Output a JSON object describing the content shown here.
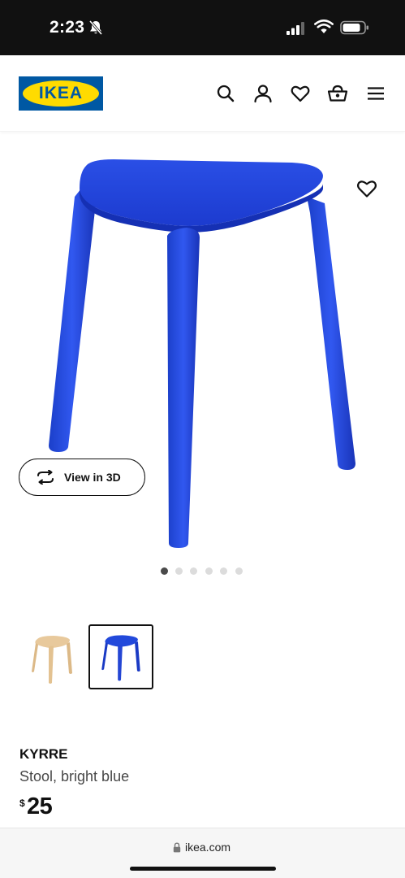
{
  "status_bar": {
    "time": "2:23",
    "icons": [
      "bell-slash-icon",
      "cellular-signal-icon",
      "wifi-icon",
      "battery-icon"
    ]
  },
  "header": {
    "logo_text": "IKEA",
    "icons": [
      "search-icon",
      "user-icon",
      "heart-icon",
      "shopping-basket-icon",
      "menu-icon"
    ]
  },
  "colors": {
    "ikea_blue": "#0058a3",
    "ikea_yellow": "#ffdb00",
    "stool_blue": "#1a3fd6"
  },
  "gallery": {
    "view_3d_label": "View in 3D",
    "dot_count": 6,
    "active_dot": 1,
    "thumbnails": [
      {
        "name": "birch",
        "selected": false
      },
      {
        "name": "bright-blue",
        "selected": true
      }
    ]
  },
  "product": {
    "name": "KYRRE",
    "description": "Stool, bright blue",
    "currency": "$",
    "price": "25"
  },
  "browser": {
    "url": "ikea.com"
  }
}
